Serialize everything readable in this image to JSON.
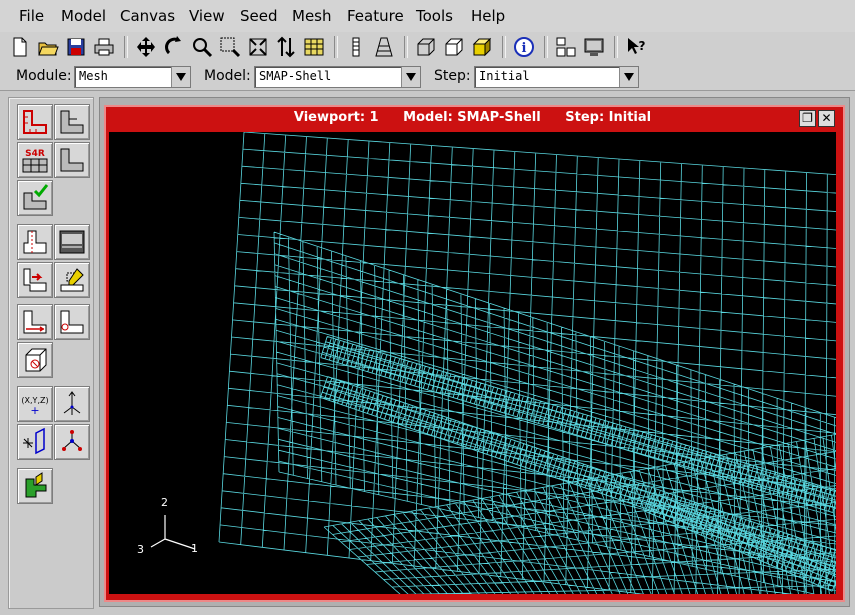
{
  "menubar": {
    "items": [
      {
        "label": "File"
      },
      {
        "label": "Model"
      },
      {
        "label": "Canvas"
      },
      {
        "label": "View"
      },
      {
        "label": "Seed"
      },
      {
        "label": "Mesh"
      },
      {
        "label": "Feature"
      },
      {
        "label": "Tools"
      },
      {
        "label": "Help"
      }
    ]
  },
  "toolbar": {
    "icons": [
      "new-file-icon",
      "open-folder-icon",
      "save-icon",
      "print-icon",
      "pan-icon",
      "rotate-icon",
      "zoom-icon",
      "box-zoom-icon",
      "auto-fit-icon",
      "cycle-views-icon",
      "grid-icon",
      "vertical-bar-icon",
      "perspective-icon",
      "wireframe-render-icon",
      "hidden-render-icon",
      "shaded-render-icon",
      "query-info-icon",
      "viewport-layout-icon",
      "viewport-display-icon",
      "context-help-icon"
    ]
  },
  "context": {
    "module_label": "Module:",
    "module_value": "Mesh",
    "model_label": "Model:",
    "model_value": "SMAP-Shell",
    "step_label": "Step:",
    "step_value": "Initial"
  },
  "toolbox": {
    "seed_badge": "S4R",
    "datum_point_label": "(X,Y,Z)"
  },
  "viewport": {
    "title_viewport": "Viewport: 1",
    "title_model": "Model: SMAP-Shell",
    "title_step": "Step: Initial",
    "triad": {
      "axis1": "1",
      "axis2": "2",
      "axis3": "3"
    },
    "mesh_color": "#5ad8e0",
    "title_bar_color": "#cc1111"
  }
}
